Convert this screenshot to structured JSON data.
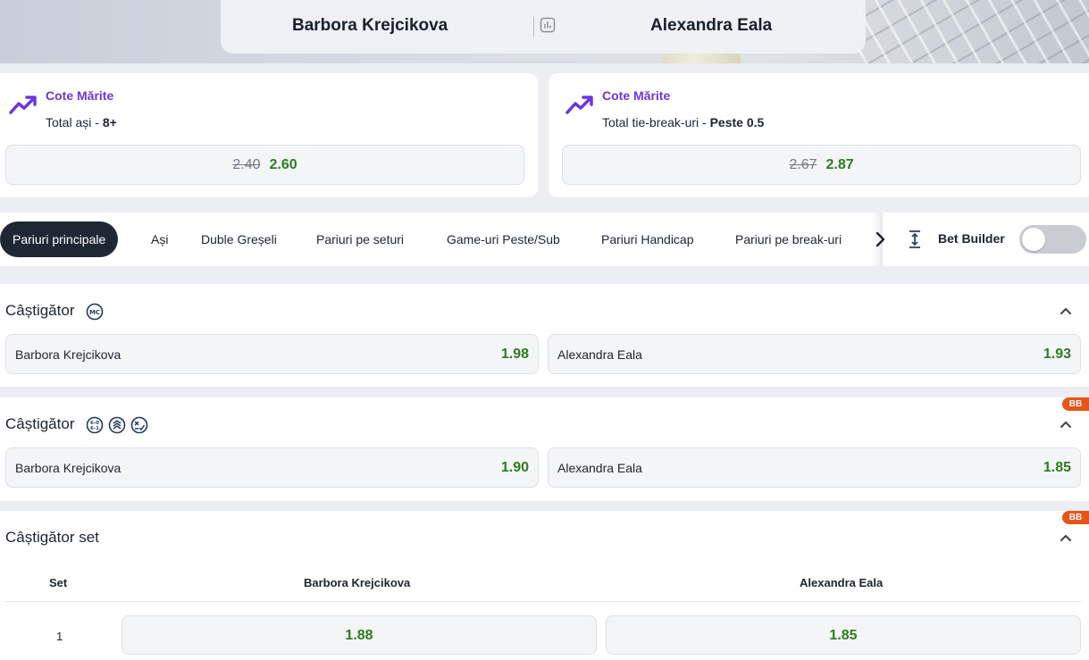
{
  "match": {
    "home": "Barbora Krejcikova",
    "away": "Alexandra Eala"
  },
  "boosts": [
    {
      "title": "Cote Mărite",
      "market": "Total ași - ",
      "selection": "8+",
      "old_odds": "2.40",
      "new_odds": "2.60"
    },
    {
      "title": "Cote Mărite",
      "market": "Total tie-break-uri - ",
      "selection": "Peste 0.5",
      "old_odds": "2.67",
      "new_odds": "2.87"
    }
  ],
  "tabs": [
    {
      "label": "Pariuri principale",
      "active": true
    },
    {
      "label": "Ași"
    },
    {
      "label": "Duble Greșeli"
    },
    {
      "label": "Pariuri pe seturi"
    },
    {
      "label": "Game-uri Peste/Sub"
    },
    {
      "label": "Pariuri Handicap"
    },
    {
      "label": "Pariuri pe break-uri"
    }
  ],
  "bet_builder": {
    "label": "Bet Builder",
    "enabled": false
  },
  "markets": [
    {
      "title": "Câștigător",
      "badges": [
        "mc-icon"
      ],
      "selections": [
        {
          "name": "Barbora Krejcikova",
          "odds": "1.98"
        },
        {
          "name": "Alexandra Eala",
          "odds": "1.93"
        }
      ]
    },
    {
      "title": "Câștigător",
      "tag": "BB",
      "badges": [
        "set-score-icon",
        "stack-icon",
        "x-check-icon"
      ],
      "selections": [
        {
          "name": "Barbora Krejcikova",
          "odds": "1.90"
        },
        {
          "name": "Alexandra Eala",
          "odds": "1.85"
        }
      ]
    },
    {
      "title": "Câștigător set",
      "tag": "BB",
      "columns": [
        "Set",
        "Barbora Krejcikova",
        "Alexandra Eala"
      ],
      "rows": [
        {
          "set": "1",
          "home": "1.88",
          "away": "1.85"
        }
      ]
    }
  ],
  "colors": {
    "accent_purple": "#6a36e0",
    "odds_green": "#2d7d1e",
    "bb_orange": "#e8541a",
    "active_tab": "#1f2733"
  }
}
